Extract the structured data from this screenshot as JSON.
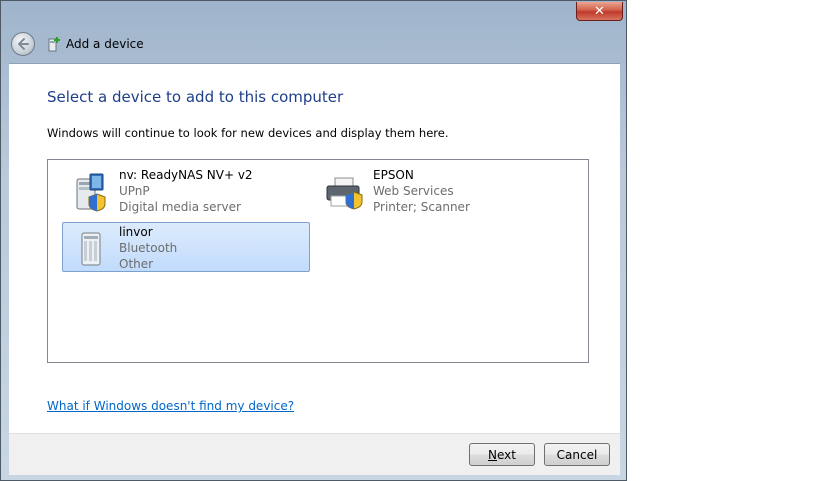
{
  "window": {
    "title": "Add a device",
    "close_label": "✕"
  },
  "main": {
    "heading": "Select a device to add to this computer",
    "subtext": "Windows will continue to look for new devices and display them here.",
    "devices": [
      {
        "name": "nv: ReadyNAS NV+ v2",
        "protocol": "UPnP",
        "type": "Digital media server",
        "icon": "nas-media-server-icon",
        "selected": false
      },
      {
        "name": "EPSON",
        "protocol": "Web Services",
        "type": "Printer; Scanner",
        "icon": "printer-icon",
        "selected": false
      },
      {
        "name": "linvor",
        "protocol": "Bluetooth",
        "type": "Other",
        "icon": "generic-device-icon",
        "selected": true
      }
    ],
    "help_link": "What if Windows doesn't find my device?"
  },
  "footer": {
    "next_accel": "N",
    "next_rest": "ext",
    "cancel_label": "Cancel"
  },
  "colors": {
    "heading": "#1e3f8a",
    "link": "#0066cc",
    "selection": "#c1dbfc"
  }
}
